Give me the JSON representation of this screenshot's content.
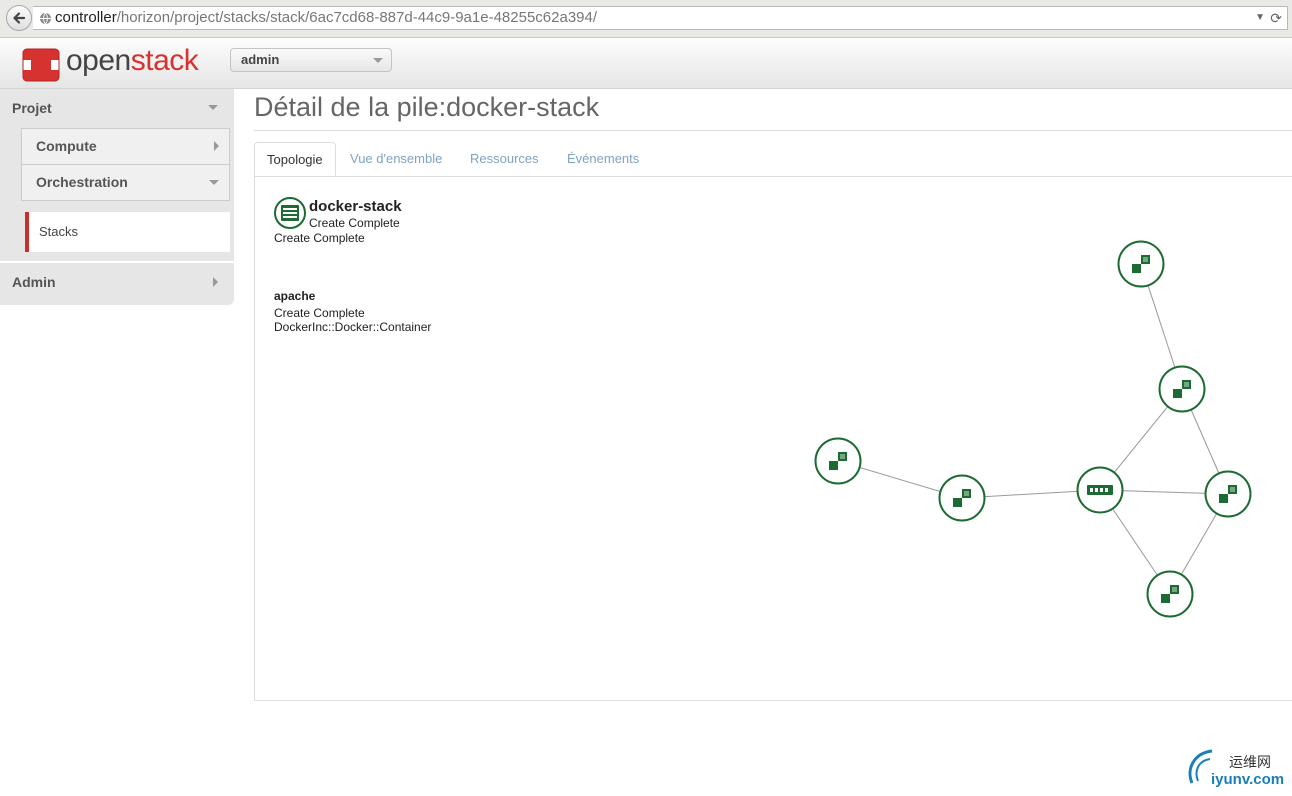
{
  "browser": {
    "url_host": "controller",
    "url_path": "/horizon/project/stacks/stack/6ac7cd68-887d-44c9-9a1e-48255c62a394/",
    "reload_glyph": "C"
  },
  "header": {
    "brand_open": "open",
    "brand_stack": "stack",
    "project_selected": "admin"
  },
  "sidebar": {
    "projet_label": "Projet",
    "compute_label": "Compute",
    "orchestration_label": "Orchestration",
    "stacks_label": "Stacks",
    "admin_label": "Admin"
  },
  "main": {
    "page_title": "Détail de la pile:docker-stack",
    "tabs": [
      {
        "label": "Topologie"
      },
      {
        "label": "Vue d'ensemble"
      },
      {
        "label": "Ressources"
      },
      {
        "label": "Événements"
      }
    ]
  },
  "topology": {
    "stack_name": "docker-stack",
    "stack_status": "Create Complete",
    "stack_status_reason": "Create Complete",
    "resource_name": "apache",
    "resource_status": "Create Complete",
    "resource_type": "DockerInc::Docker::Container",
    "node_color": "#1c6b32",
    "link_color": "#999999"
  },
  "watermark": {
    "cn": "运维网",
    "en": "iyunv.com"
  }
}
